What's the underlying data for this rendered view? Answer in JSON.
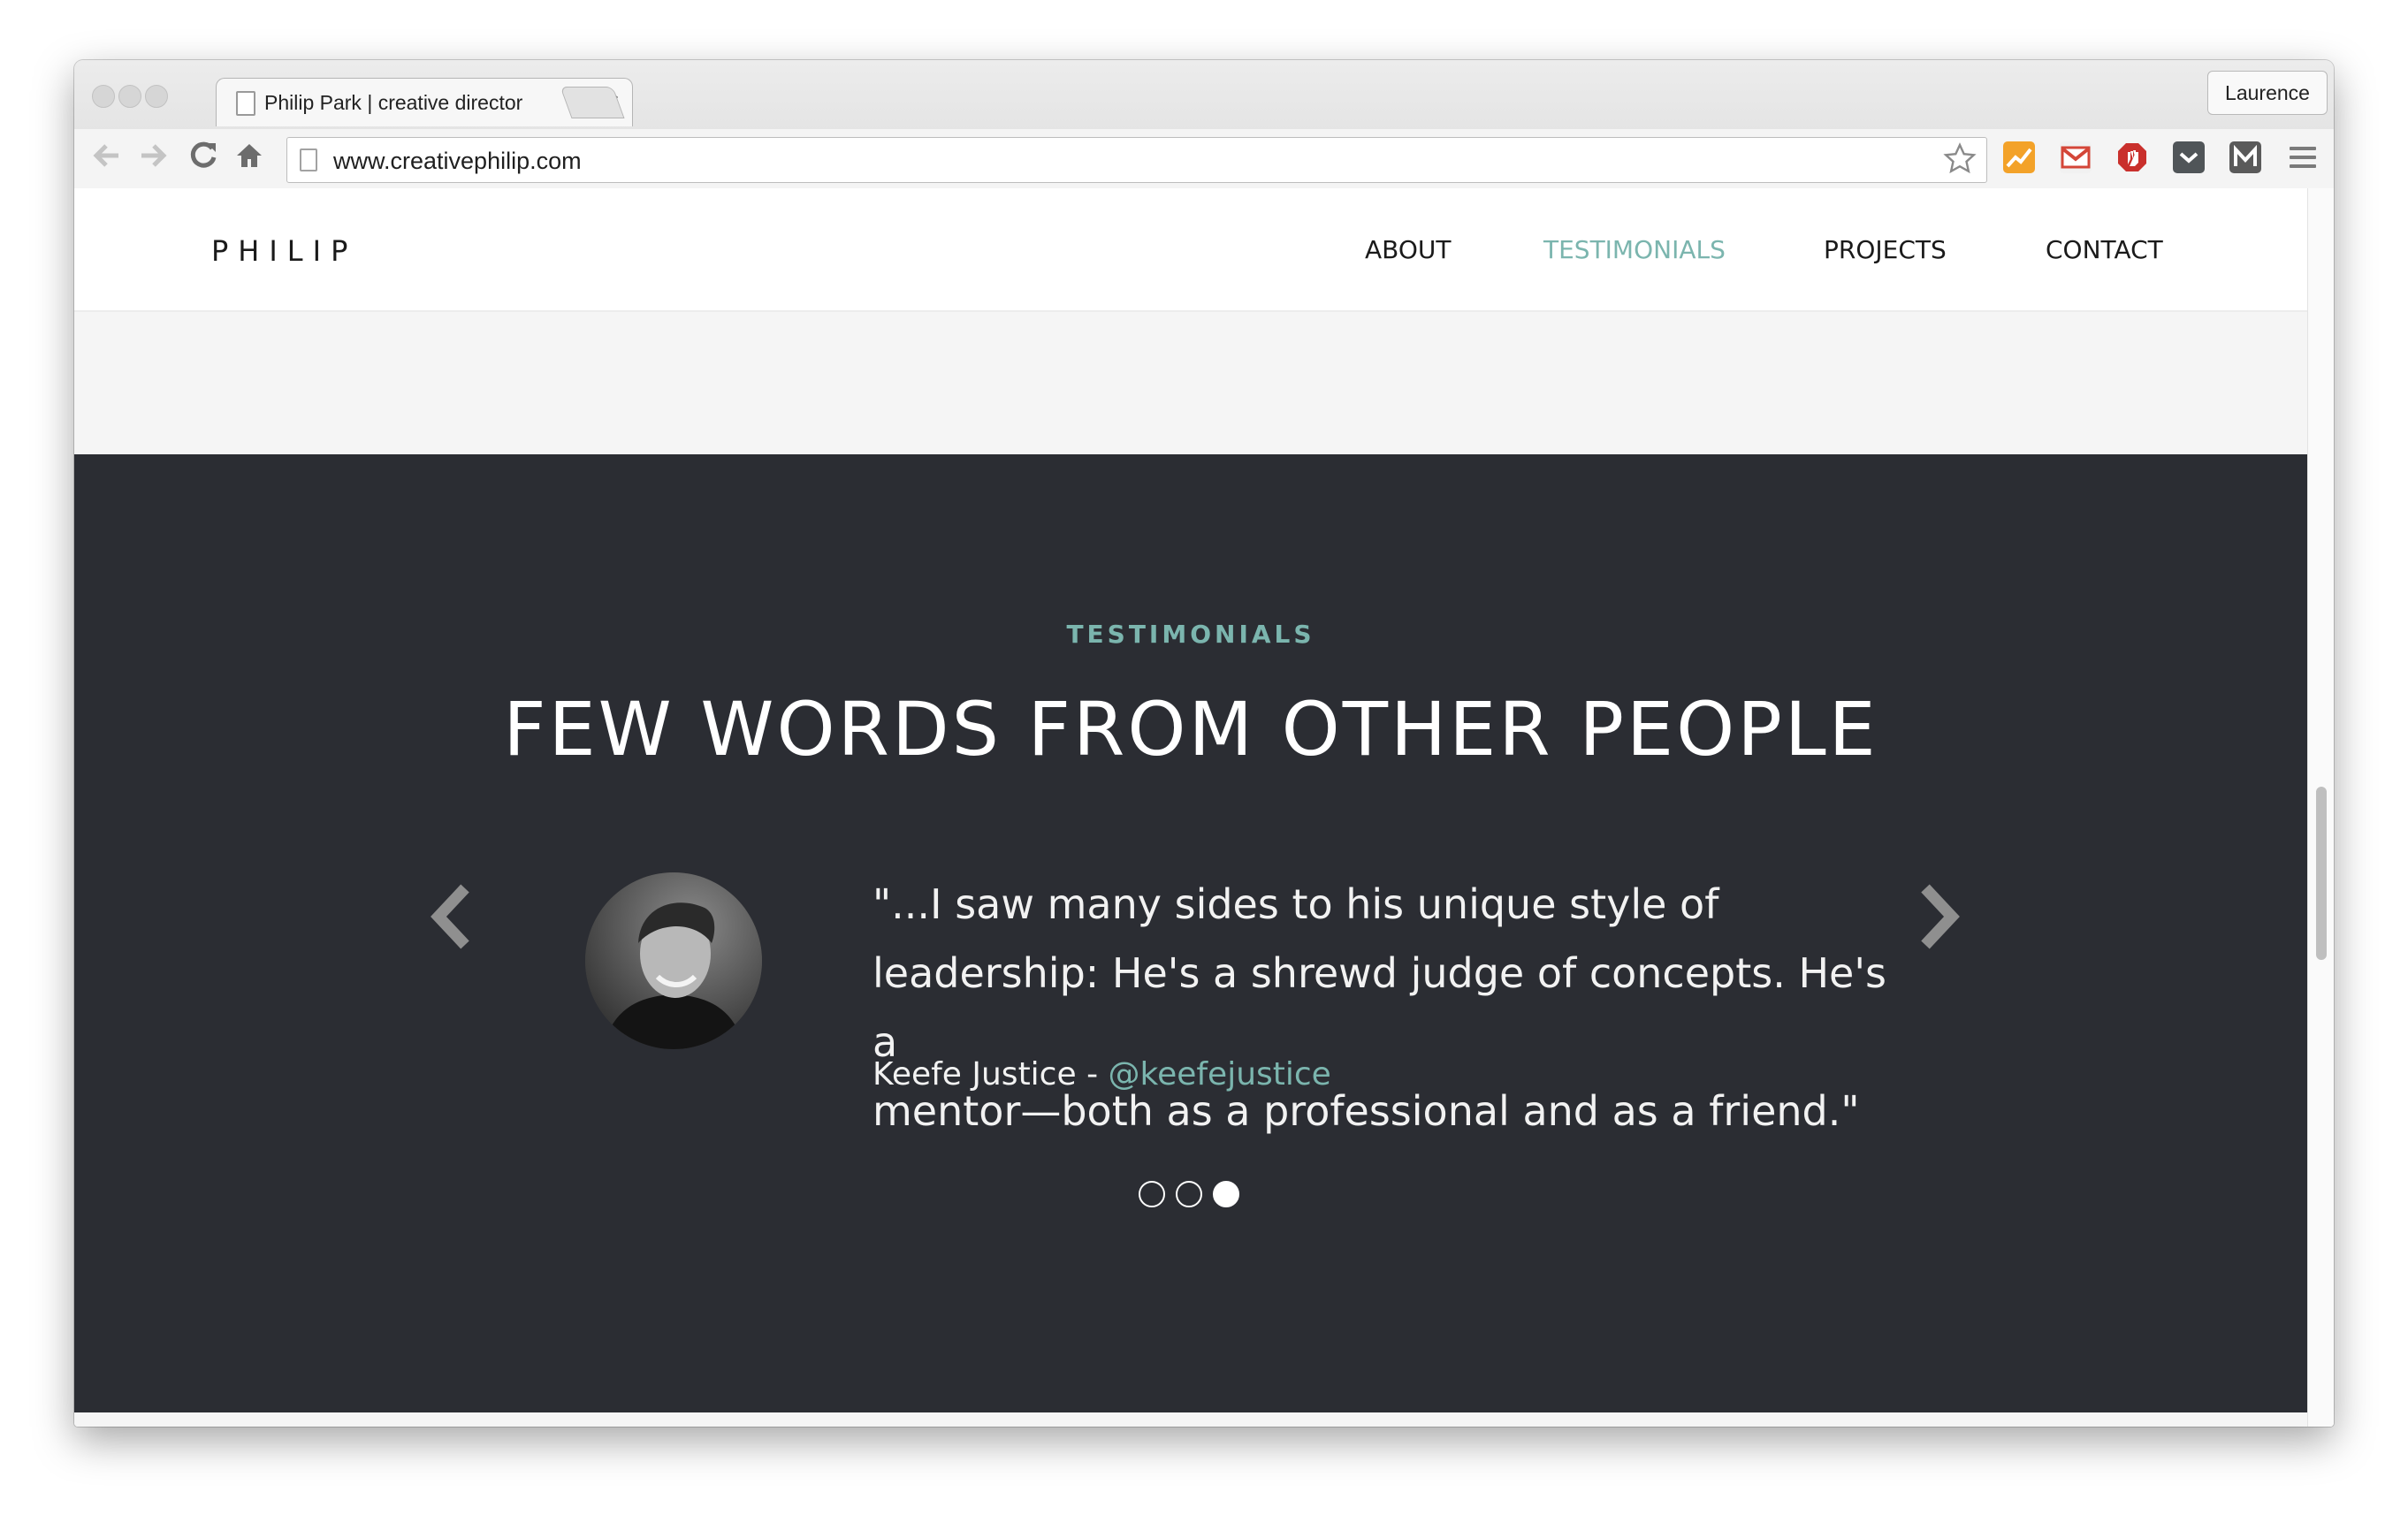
{
  "browser": {
    "tab_title": "Philip Park | creative director",
    "tab_close": "×",
    "profile_name": "Laurence",
    "url": "www.creativephilip.com",
    "back_icon": "arrow-left-icon",
    "forward_icon": "arrow-right-icon",
    "reload_icon": "reload-icon",
    "home_icon": "home-icon",
    "bookmark_icon": "star-icon",
    "extensions": [
      {
        "name": "analytics-extension-icon",
        "color": "#f3a229"
      },
      {
        "name": "gmail-extension-icon",
        "color": "#d44638"
      },
      {
        "name": "adblock-extension-icon",
        "color": "#c9302c"
      },
      {
        "name": "pocket-extension-icon",
        "color": "#505558"
      },
      {
        "name": "medium-extension-icon",
        "color": "#5a5a5a"
      }
    ],
    "menu_icon": "hamburger-menu-icon"
  },
  "site": {
    "logo": "PHILIP",
    "nav": [
      {
        "label": "ABOUT",
        "active": false
      },
      {
        "label": "TESTIMONIALS",
        "active": true
      },
      {
        "label": "PROJECTS",
        "active": false
      },
      {
        "label": "CONTACT",
        "active": false
      }
    ],
    "accent_color": "#7bb5ae",
    "dark_bg_color": "#2b2d33"
  },
  "testimonials": {
    "eyebrow": "TESTIMONIALS",
    "headline": "FEW WORDS FROM OTHER PEOPLE",
    "quote_lines": [
      "\"...I saw many sides to his unique style of",
      "leadership: He's a shrewd judge of concepts. He's a",
      "mentor—both as a professional and as a friend.\""
    ],
    "author_name": "Keefe Justice",
    "author_separator": " - ",
    "author_handle": "@keefejustice",
    "prev_icon": "chevron-left-icon",
    "next_icon": "chevron-right-icon",
    "slides_total": 3,
    "active_slide": 3
  }
}
